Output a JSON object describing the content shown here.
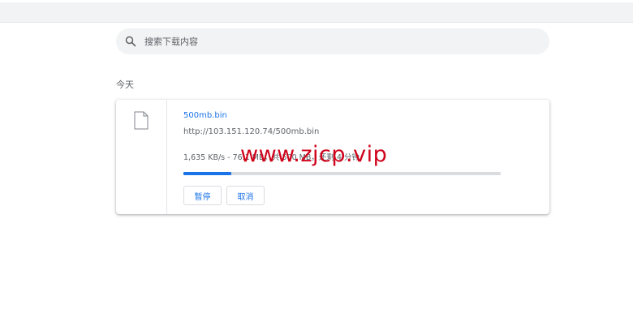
{
  "search": {
    "placeholder": "搜索下载内容",
    "icon": "search-icon"
  },
  "section": {
    "date_label": "今天"
  },
  "download": {
    "file_name": "500mb.bin",
    "url": "http://103.151.120.74/500mb.bin",
    "status": "1,635 KB/s - 76.1 MB，共 500 MB，还剩 4 分钟",
    "progress": 0.15,
    "pause_label": "暂停",
    "cancel_label": "取消",
    "file_icon": "file-icon"
  },
  "watermark": {
    "text": "www.zjcp.vip"
  },
  "colors": {
    "accent": "#1a73e8",
    "watermark": "#d0021b"
  }
}
